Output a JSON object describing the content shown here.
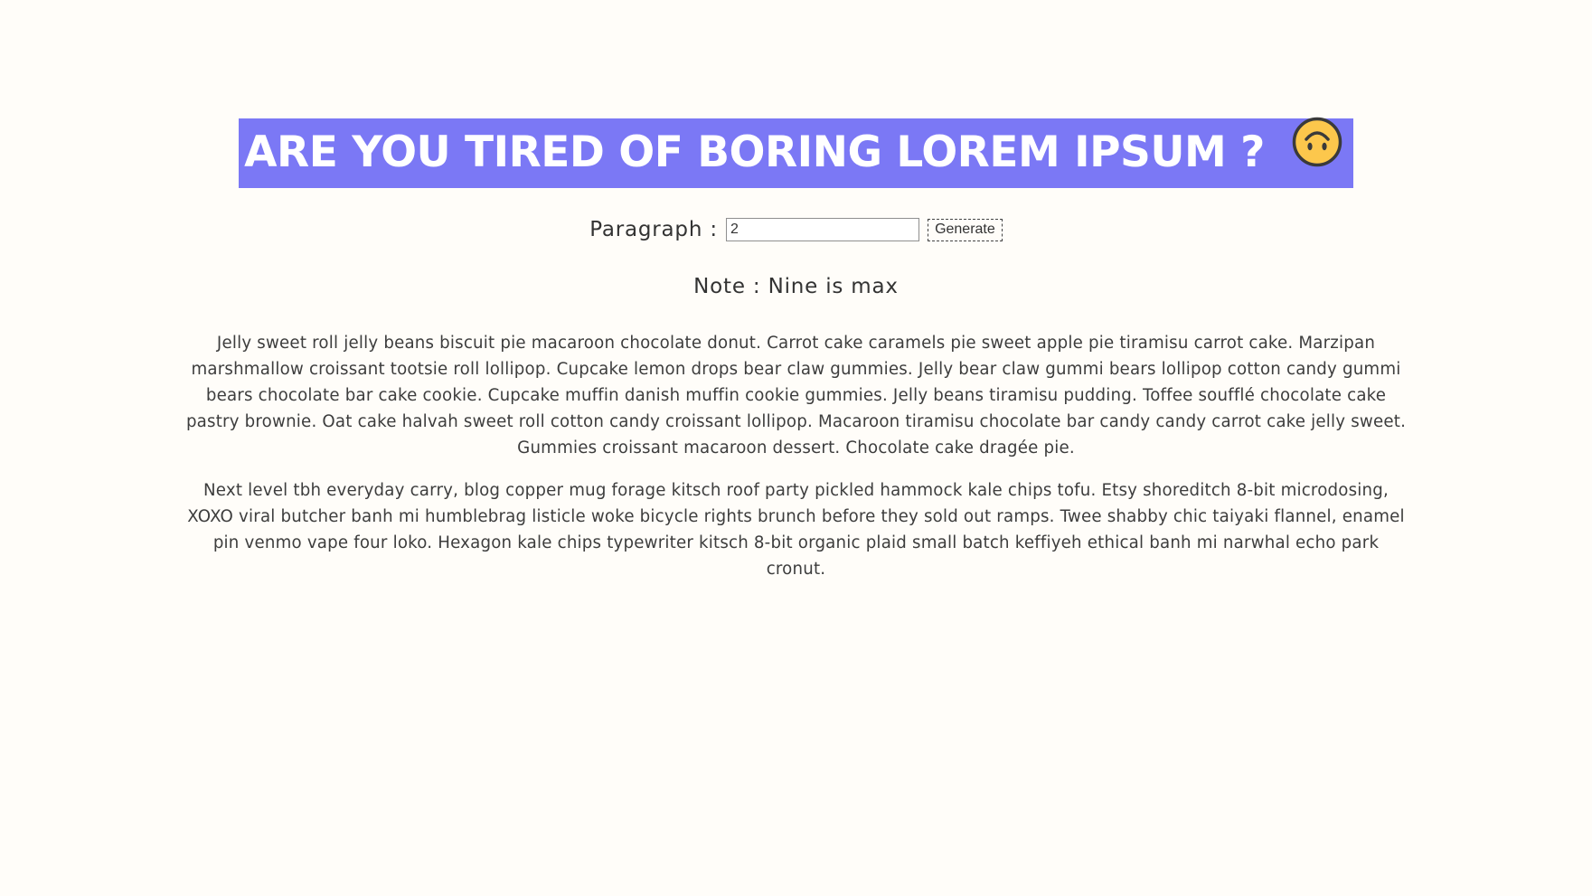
{
  "banner": {
    "title": "ARE YOU TIRED OF BORING LOREM IPSUM ?",
    "emoji_icon": "upside-down-face-icon",
    "background_color": "#7b78f5"
  },
  "controls": {
    "paragraph_label": "Paragraph :",
    "paragraph_value": "2",
    "generate_label": "Generate"
  },
  "note": "Note : Nine is max",
  "paragraphs": [
    "Jelly sweet roll jelly beans biscuit pie macaroon chocolate donut. Carrot cake caramels pie sweet apple pie tiramisu carrot cake. Marzipan marshmallow croissant tootsie roll lollipop. Cupcake lemon drops bear claw gummies. Jelly bear claw gummi bears lollipop cotton candy gummi bears chocolate bar cake cookie. Cupcake muffin danish muffin cookie gummies. Jelly beans tiramisu pudding. Toffee soufflé chocolate cake pastry brownie. Oat cake halvah sweet roll cotton candy croissant lollipop. Macaroon tiramisu chocolate bar candy candy carrot cake jelly sweet. Gummies croissant macaroon dessert. Chocolate cake dragée pie.",
    "Next level tbh everyday carry, blog copper mug forage kitsch roof party pickled hammock kale chips tofu. Etsy shoreditch 8-bit microdosing, XOXO viral butcher banh mi humblebrag listicle woke bicycle rights brunch before they sold out ramps. Twee shabby chic taiyaki flannel, enamel pin venmo vape four loko. Hexagon kale chips typewriter kitsch 8-bit organic plaid small batch keffiyeh ethical banh mi narwhal echo park cronut."
  ]
}
